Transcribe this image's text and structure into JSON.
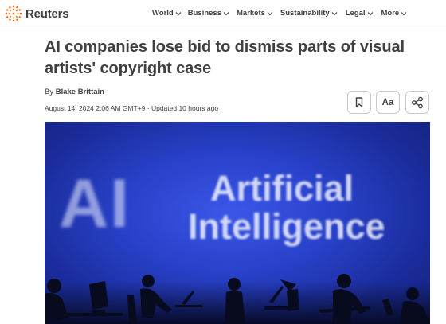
{
  "brand": {
    "name": "Reuters",
    "accent": "#fa6400"
  },
  "nav": {
    "items": [
      {
        "label": "World",
        "icon": "chevron-down-icon"
      },
      {
        "label": "Business",
        "icon": "chevron-down-icon"
      },
      {
        "label": "Markets",
        "icon": "chevron-down-icon"
      },
      {
        "label": "Sustainability",
        "icon": "chevron-down-icon"
      },
      {
        "label": "Legal",
        "icon": "chevron-down-icon"
      },
      {
        "label": "More",
        "icon": "chevron-down-icon"
      }
    ]
  },
  "article": {
    "headline": "AI companies lose bid to dismiss parts of visual artists' copyright case",
    "byline_prefix": "By",
    "author": "Blake Brittain",
    "dateline": "August 14, 2024 2:06 AM GMT+9 · Updated 10 hours ago"
  },
  "actions": {
    "bookmark_icon": "bookmark-icon",
    "text_size_label": "Aa",
    "share_icon": "share-icon"
  },
  "hero": {
    "text_large": "AI",
    "text_line1": "Artificial",
    "text_line2": "Intelligence"
  }
}
